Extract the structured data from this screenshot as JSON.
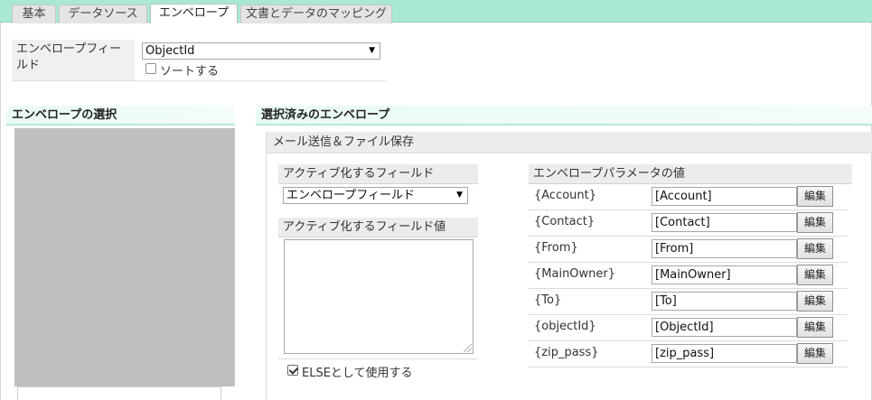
{
  "tabs": [
    {
      "label": "基本",
      "active": false
    },
    {
      "label": "データソース",
      "active": false
    },
    {
      "label": "エンベロープ",
      "active": true
    },
    {
      "label": "文書とデータのマッピング",
      "active": false
    }
  ],
  "envelope_field": {
    "label": "エンベロープフィールド",
    "selected_value": "ObjectId",
    "sort_label": "ソートする",
    "sort_checked": false
  },
  "envelope_selection": {
    "header": "エンベロープの選択"
  },
  "selected_envelopes": {
    "header": "選択済みのエンベロープ",
    "panel_title": "メール送信＆ファイル保存",
    "active_field": {
      "header": "アクティブ化するフィールド",
      "selected_value": "エンベロープフィールド"
    },
    "active_field_value": {
      "header": "アクティブ化するフィールド値",
      "value": ""
    },
    "use_as_else": {
      "label": "ELSEとして使用する",
      "checked": true
    },
    "parameters": {
      "header": "エンベロープパラメータの値",
      "edit_label": "編集",
      "rows": [
        {
          "name": "{Account}",
          "value": "[Account]"
        },
        {
          "name": "{Contact}",
          "value": "[Contact]"
        },
        {
          "name": "{From}",
          "value": "[From]"
        },
        {
          "name": "{MainOwner}",
          "value": "[MainOwner]"
        },
        {
          "name": "{To}",
          "value": "[To]"
        },
        {
          "name": "{objectId}",
          "value": "[ObjectId]"
        },
        {
          "name": "{zip_pass}",
          "value": "[zip_pass]"
        }
      ]
    }
  },
  "colors": {
    "tab_bar": "#a8e8d4",
    "section_header_bg": "#e9fbf5",
    "list_placeholder": "#bfbfbf"
  }
}
